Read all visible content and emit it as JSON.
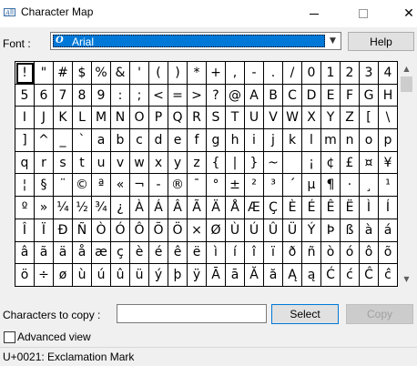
{
  "window": {
    "title": "Character Map",
    "minimize_icon": "minimize-icon",
    "maximize_icon": "maximize-icon",
    "close_icon": "close-icon"
  },
  "font": {
    "label": "Font :",
    "selected": "Arial",
    "help_label": "Help"
  },
  "grid": {
    "characters": [
      "!",
      "\"",
      "#",
      "$",
      "%",
      "&",
      "'",
      "(",
      ")",
      "*",
      "+",
      ",",
      "-",
      ".",
      "/",
      "0",
      "1",
      "2",
      "3",
      "4",
      "5",
      "6",
      "7",
      "8",
      "9",
      ":",
      ";",
      "<",
      "=",
      ">",
      "?",
      "@",
      "A",
      "B",
      "C",
      "D",
      "E",
      "F",
      "G",
      "H",
      "I",
      "J",
      "K",
      "L",
      "M",
      "N",
      "O",
      "P",
      "Q",
      "R",
      "S",
      "T",
      "U",
      "V",
      "W",
      "X",
      "Y",
      "Z",
      "[",
      "\\",
      "]",
      "^",
      "_",
      "`",
      "a",
      "b",
      "c",
      "d",
      "e",
      "f",
      "g",
      "h",
      "i",
      "j",
      "k",
      "l",
      "m",
      "n",
      "o",
      "p",
      "q",
      "r",
      "s",
      "t",
      "u",
      "v",
      "w",
      "x",
      "y",
      "z",
      "{",
      "|",
      "}",
      "~",
      " ",
      "¡",
      "¢",
      "£",
      "¤",
      "¥",
      "¦",
      "§",
      "¨",
      "©",
      "ª",
      "«",
      "¬",
      "-",
      "®",
      "¯",
      "°",
      "±",
      "²",
      "³",
      "´",
      "µ",
      "¶",
      "·",
      "¸",
      "¹",
      "º",
      "»",
      "¼",
      "½",
      "¾",
      "¿",
      "À",
      "Á",
      "Â",
      "Ã",
      "Ä",
      "Å",
      "Æ",
      "Ç",
      "È",
      "É",
      "Ê",
      "Ë",
      "Ì",
      "Í",
      "Î",
      "Ï",
      "Ð",
      "Ñ",
      "Ò",
      "Ó",
      "Ô",
      "Õ",
      "Ö",
      "×",
      "Ø",
      "Ù",
      "Ú",
      "Û",
      "Ü",
      "Ý",
      "Þ",
      "ß",
      "à",
      "á",
      "â",
      "ã",
      "ä",
      "å",
      "æ",
      "ç",
      "è",
      "é",
      "ê",
      "ë",
      "ì",
      "í",
      "î",
      "ï",
      "ð",
      "ñ",
      "ò",
      "ó",
      "ô",
      "õ",
      "ö",
      "÷",
      "ø",
      "ù",
      "ú",
      "û",
      "ü",
      "ý",
      "þ",
      "ÿ",
      "Ā",
      "ā",
      "Ă",
      "ă",
      "Ą",
      "ą",
      "Ć",
      "ć",
      "Ĉ",
      "ĉ"
    ],
    "selected_index": 0
  },
  "scrollbar": {
    "up_icon": "scroll-up-icon",
    "down_icon": "scroll-down-icon"
  },
  "copy": {
    "label": "Characters to copy :",
    "value": "",
    "select_label": "Select",
    "copy_label": "Copy"
  },
  "advanced": {
    "label": "Advanced view",
    "checked": false
  },
  "status": {
    "text": "U+0021: Exclamation Mark"
  },
  "colors": {
    "accent": "#0078d7",
    "window_bg": "#f0f0f0"
  }
}
